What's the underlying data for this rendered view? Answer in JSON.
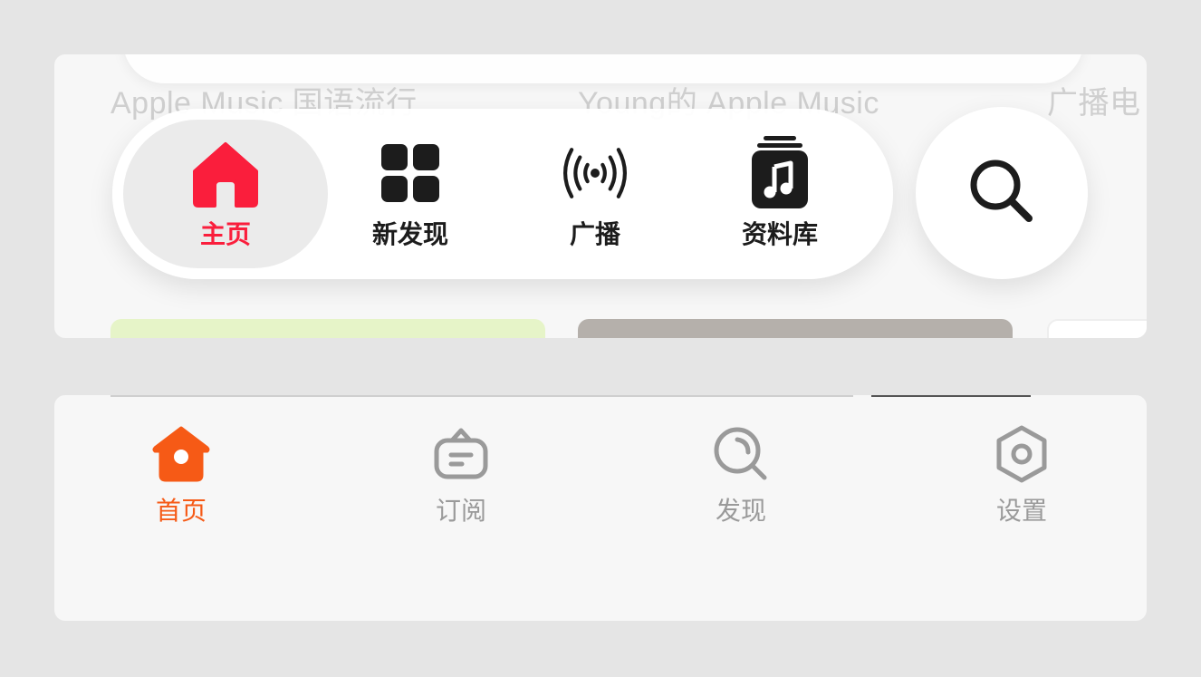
{
  "top_app": {
    "background_text": {
      "line_top_left": "Apple Music 国语流行",
      "line_top_middle": "Young的 Apple Music",
      "line_top_right": "广播电"
    },
    "tabs": [
      {
        "label": "主页",
        "icon": "house-icon",
        "active": true
      },
      {
        "label": "新发现",
        "icon": "grid-icon",
        "active": false
      },
      {
        "label": "广播",
        "icon": "broadcast-icon",
        "active": false
      },
      {
        "label": "资料库",
        "icon": "music-library-icon",
        "active": false
      }
    ],
    "search_icon": "search-icon",
    "accent_color": "#fa1e3c"
  },
  "bottom_app": {
    "tabs": [
      {
        "label": "首页",
        "icon": "home-icon",
        "active": true
      },
      {
        "label": "订阅",
        "icon": "subscription-icon",
        "active": false
      },
      {
        "label": "发现",
        "icon": "discover-icon",
        "active": false
      },
      {
        "label": "设置",
        "icon": "settings-icon",
        "active": false
      }
    ],
    "accent_color": "#f65a16",
    "inactive_color": "#9a9a9a"
  }
}
